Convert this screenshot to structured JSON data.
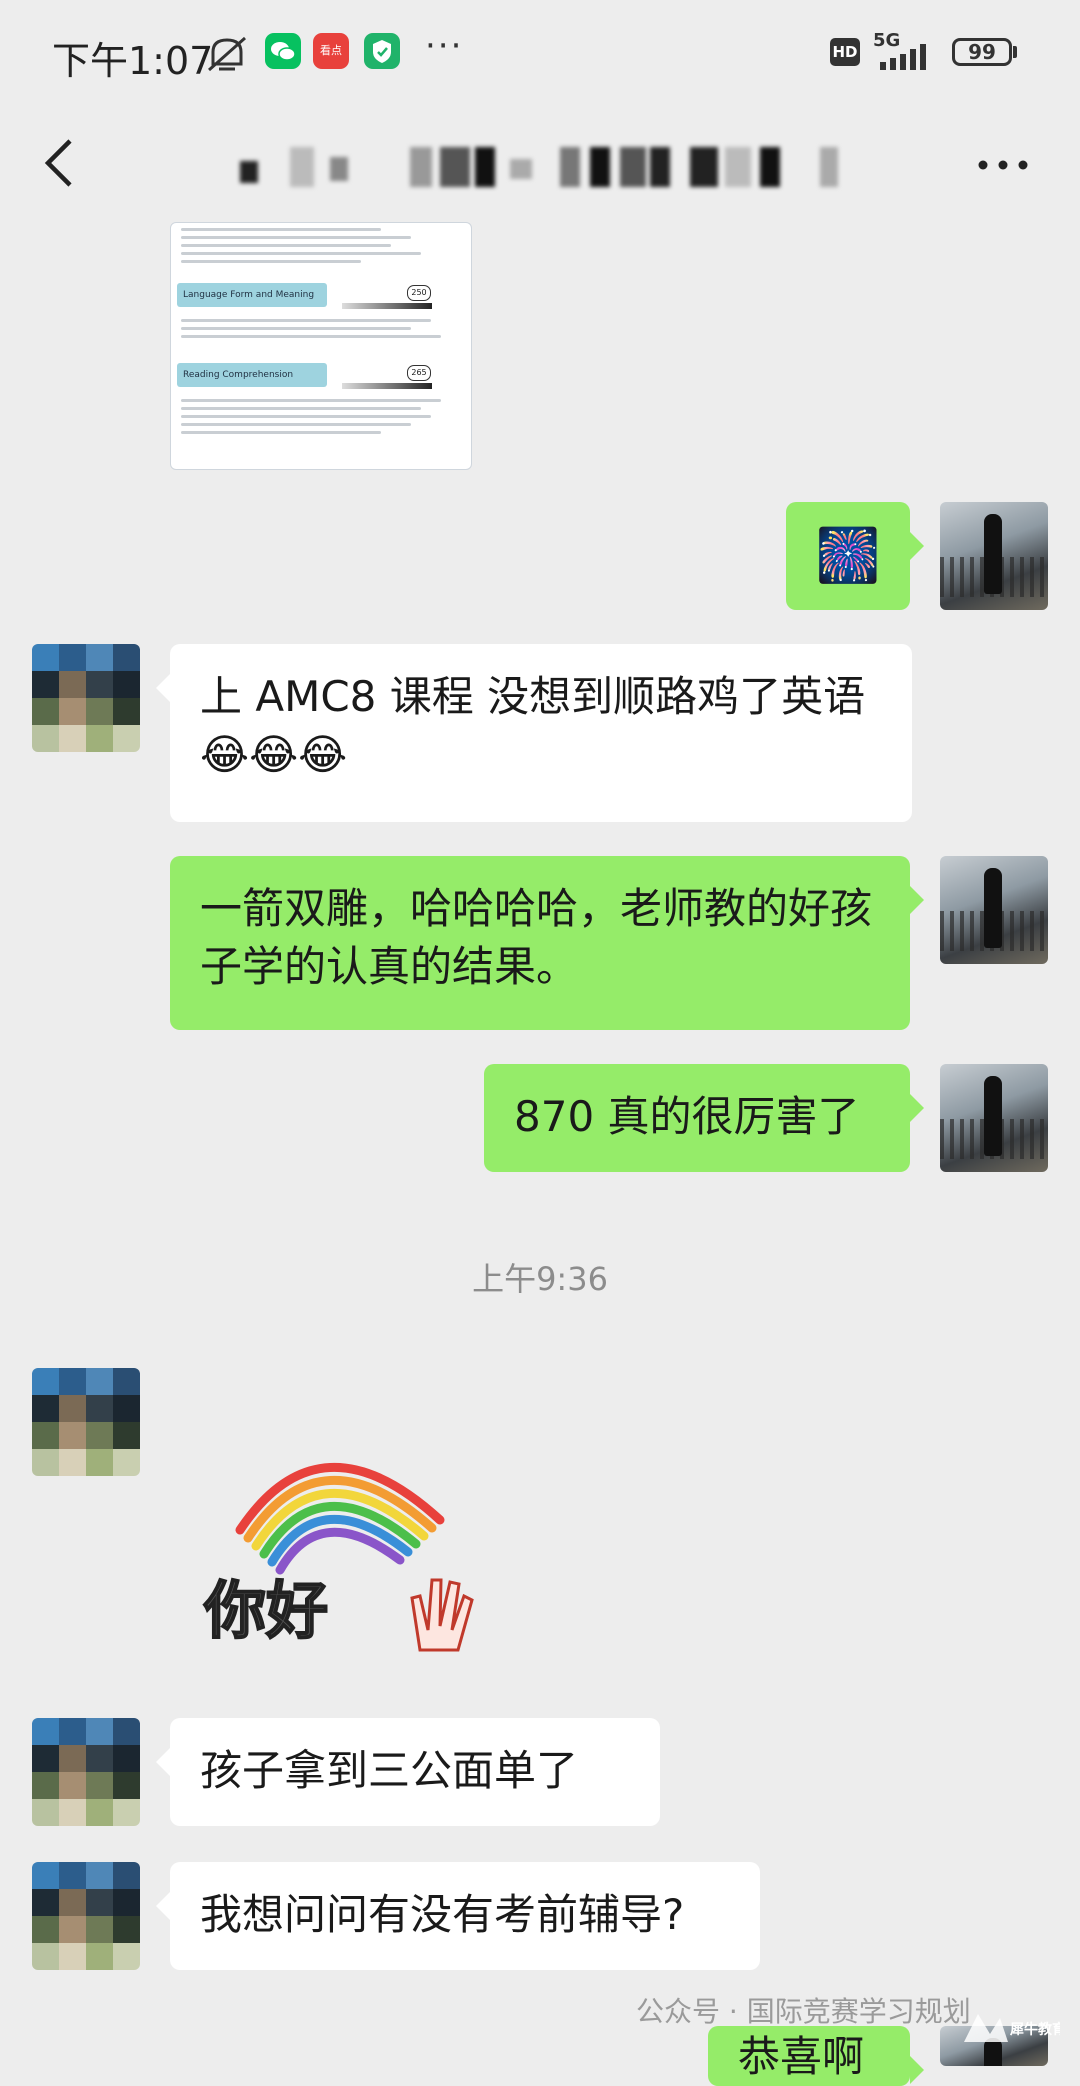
{
  "status_bar": {
    "time": "下午1:07",
    "dots": "···",
    "hd": "HD",
    "network": "5G",
    "battery": "99",
    "kandian_badge": "看点",
    "icons": [
      "mute-icon",
      "wechat-icon",
      "kandian-icon",
      "shield-icon",
      "signal-icon",
      "battery-icon"
    ]
  },
  "header": {
    "title": "",
    "back_icon": "back-chevron-icon",
    "more_icon": "more-dots-icon",
    "more_label": "···"
  },
  "document_image": {
    "section2_title": "Language Form and Meaning",
    "section2_score": "250",
    "section3_title": "Reading Comprehension",
    "section3_score": "265"
  },
  "messages": [
    {
      "side": "right",
      "kind": "emoji",
      "text": "🎆"
    },
    {
      "side": "left",
      "kind": "text",
      "text": "上 AMC8 课程 没想到顺路鸡了英语😂😂😂"
    },
    {
      "side": "right",
      "kind": "text",
      "text": "一箭双雕，哈哈哈哈，老师教的好孩子学的认真的结果。"
    },
    {
      "side": "right",
      "kind": "text",
      "text": "870 真的很厉害了"
    },
    {
      "side": "left",
      "kind": "sticker",
      "text": "你好"
    },
    {
      "side": "left",
      "kind": "text",
      "text": "孩子拿到三公面单了"
    },
    {
      "side": "left",
      "kind": "text",
      "text": "我想问问有没有考前辅导?"
    },
    {
      "side": "right",
      "kind": "text",
      "text": "恭喜啊"
    }
  ],
  "timestamp": "上午9:36",
  "watermark": {
    "text": "公众号 · 国际竞赛学习规划",
    "logo": "犀牛教育"
  },
  "colors": {
    "background": "#ededed",
    "bubble_self": "#95ec69",
    "bubble_other": "#ffffff",
    "timestamp": "#8c8c8c"
  }
}
